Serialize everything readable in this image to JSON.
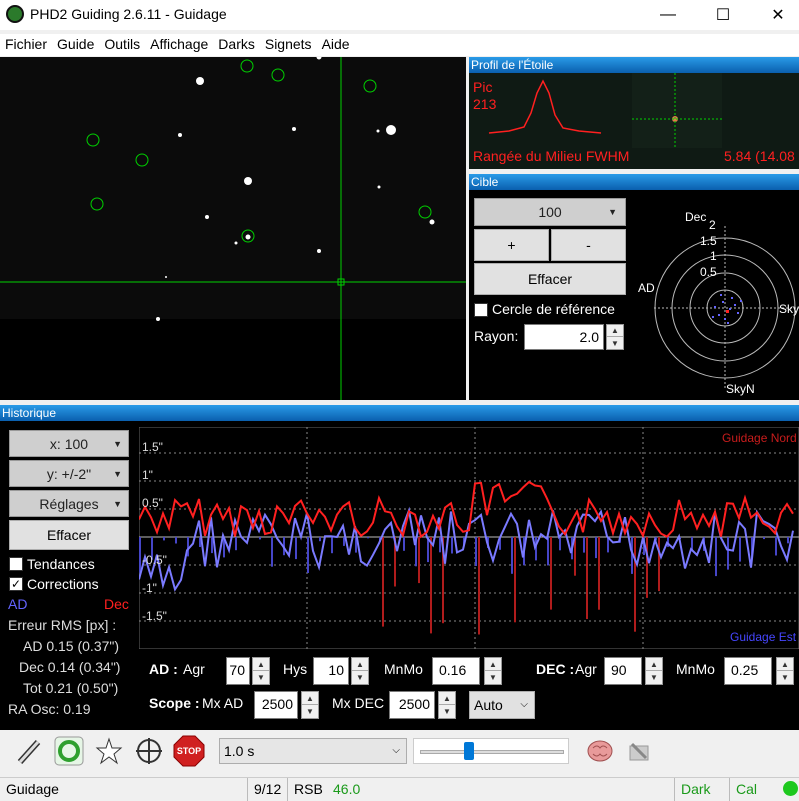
{
  "window": {
    "title": "PHD2 Guiding 2.6.11 - Guidage",
    "min": "—",
    "max": "☐",
    "close": "✕"
  },
  "menu": [
    "Fichier",
    "Guide",
    "Outils",
    "Affichage",
    "Darks",
    "Signets",
    "Aide"
  ],
  "profile": {
    "header": "Profil de l'Étoile",
    "pic_label": "Pic",
    "pic_value": "213",
    "range_label": "Rangée du Milieu FWHM",
    "fwhm_value": "5.84 (14.08"
  },
  "cible": {
    "header": "Cible",
    "scale_value": "100",
    "plus": "+",
    "minus": "-",
    "clear": "Effacer",
    "ref_circle_label": "Cercle de référence",
    "radius_label": "Rayon:",
    "radius_value": "2.0",
    "axis_dec": "Dec",
    "axis_ad": "AD",
    "axis_skyw": "SkyW",
    "axis_skyn": "SkyN",
    "ring_labels": [
      "2",
      "1.5",
      "1",
      "0.5"
    ]
  },
  "history": {
    "header": "Historique",
    "x_scale": "x: 100",
    "y_scale": "y: +/-2\"",
    "settings": "Réglages",
    "clear": "Effacer",
    "trends_label": "Tendances",
    "corrections_label": "Corrections",
    "legend_ad": "AD",
    "legend_dec": "Dec",
    "rms_title": "Erreur RMS [px] :",
    "rms_ad": "AD 0.15 (0.37\")",
    "rms_dec": "Dec 0.14 (0.34\")",
    "rms_tot": "Tot 0.21 (0.50\")",
    "ra_osc": "RA Osc: 0.19",
    "y_labels": [
      "1.5\"",
      "1\"",
      "0.5\"",
      "-0.5\"",
      "-1\"",
      "-1.5\""
    ],
    "guide_north": "Guidage Nord",
    "guide_east": "Guidage Est",
    "ad_label": "AD :",
    "agr_label": "Agr",
    "ad_agr": "70",
    "hys_label": "Hys",
    "ad_hys": "10",
    "mnmo_label": "MnMo",
    "ad_mnmo": "0.16",
    "dec_label": "DEC :",
    "dec_agr": "90",
    "dec_mnmo": "0.25",
    "scope_label": "Scope :",
    "mx_ad_label": "Mx AD",
    "mx_ad": "2500",
    "mx_dec_label": "Mx DEC",
    "mx_dec": "2500",
    "mode": "Auto"
  },
  "toolbar": {
    "exposure": "1.0 s",
    "stop": "STOP",
    "slider_fraction": 0.33
  },
  "status": {
    "state": "Guidage",
    "frames": "9/12",
    "snr_label": "RSB",
    "snr_value": "46.0",
    "dark": "Dark",
    "cal": "Cal"
  },
  "colors": {
    "ra": "#6464ff",
    "dec": "#ff2020",
    "crosshair": "#00d000",
    "accent": "#0a5fae"
  },
  "icons": [
    "telescope-icon",
    "loop-icon",
    "star-select-icon",
    "guide-crosshair-icon",
    "stop-icon",
    "brain-icon",
    "tools-icon"
  ]
}
